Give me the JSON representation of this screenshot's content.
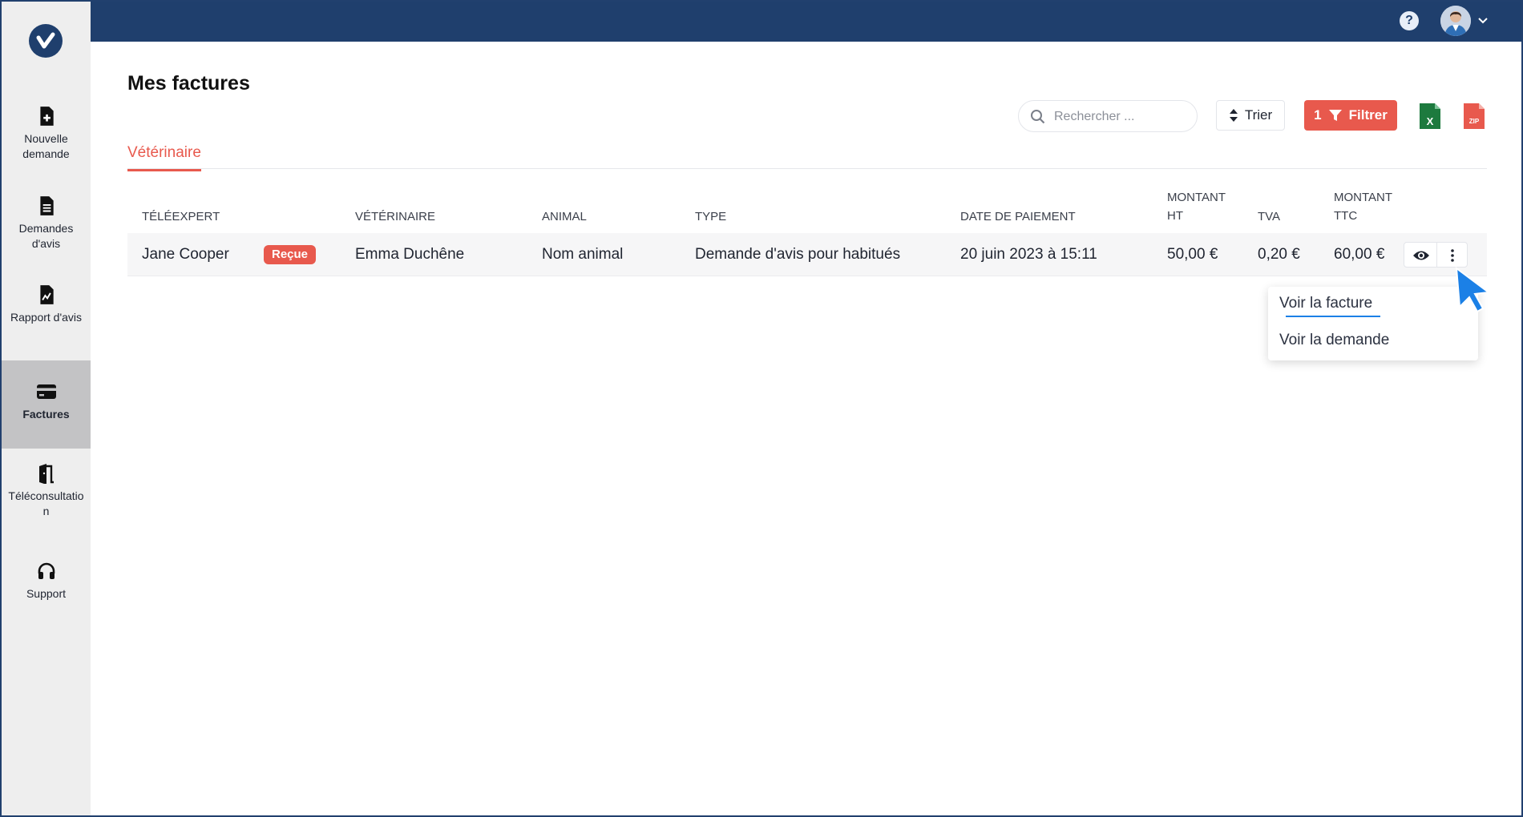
{
  "app": {
    "page_title": "Mes factures",
    "help_label": "?"
  },
  "sidebar": {
    "items": [
      {
        "label": "Nouvelle demande",
        "icon": "file-plus-icon"
      },
      {
        "label": "Demandes d'avis",
        "icon": "file-text-icon"
      },
      {
        "label": "Rapport d'avis",
        "icon": "file-chart-icon"
      },
      {
        "label": "Factures",
        "icon": "credit-card-icon",
        "active": true
      },
      {
        "label": "Téléconsultation",
        "icon": "door-exit-icon"
      },
      {
        "label": "Support",
        "icon": "headphones-icon"
      }
    ]
  },
  "toolbar": {
    "search_placeholder": "Rechercher ...",
    "sort_label": "Trier",
    "filter_count": "1",
    "filter_label": "Filtrer",
    "zip_label": "ZIP",
    "xls_label": "X"
  },
  "tabs": [
    {
      "label": "Vétérinaire",
      "active": true
    }
  ],
  "table": {
    "headers": {
      "teleexpert": "TÉLÉEXPERT",
      "veterinaire": "VÉTÉRINAIRE",
      "animal": "ANIMAL",
      "type": "TYPE",
      "date": "DATE DE PAIEMENT",
      "montant_ht_1": "MONTANT",
      "montant_ht_2": "HT",
      "tva": "TVA",
      "montant_ttc_1": "MONTANT",
      "montant_ttc_2": "TTC"
    },
    "rows": [
      {
        "teleexpert": "Jane Cooper",
        "status": "Reçue",
        "veterinaire": "Emma Duchêne",
        "animal": "Nom animal",
        "type": "Demande d'avis pour habitués",
        "date": "20 juin 2023 à 15:11",
        "montant_ht": "50,00 €",
        "tva": "0,20 €",
        "montant_ttc": "60,00 €"
      }
    ]
  },
  "row_menu": {
    "items": [
      "Voir la facture",
      "Voir la demande"
    ]
  },
  "colors": {
    "topbar": "#1f3f6d",
    "accent": "#e8594d",
    "sidebar_bg": "#eeeeee",
    "sidebar_active": "#c3c3c5",
    "link_underline": "#1b80e6",
    "excel": "#1d7a3e"
  }
}
